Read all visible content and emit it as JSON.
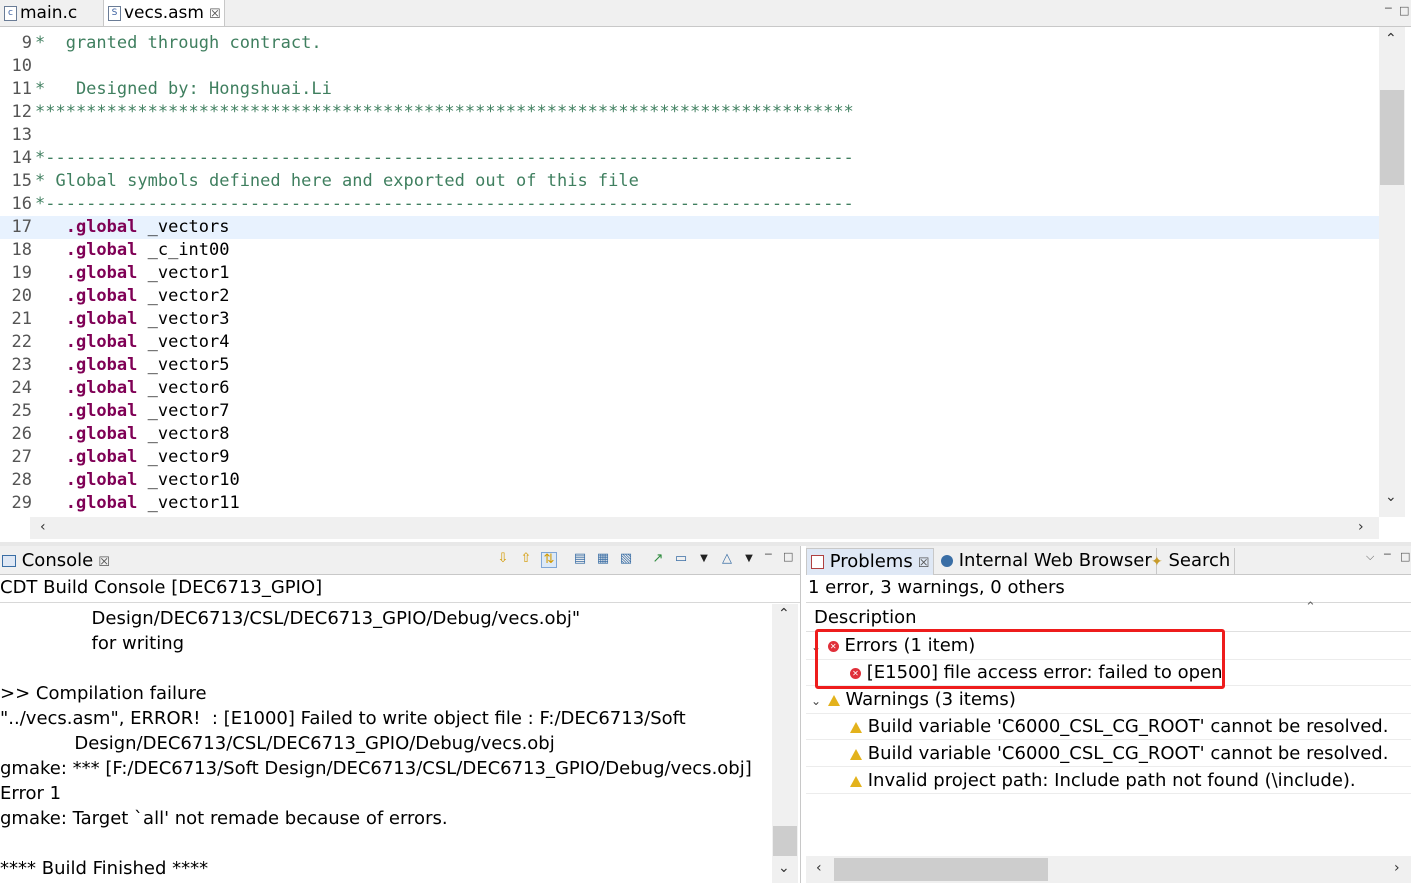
{
  "editor": {
    "tabs": [
      {
        "label": "main.c",
        "active": false
      },
      {
        "label": "vecs.asm",
        "active": true,
        "close": "☒"
      }
    ],
    "lines": [
      {
        "num": "9",
        "parts": [
          {
            "t": "*  granted through contract.",
            "c": "cm"
          }
        ]
      },
      {
        "num": "10",
        "parts": []
      },
      {
        "num": "11",
        "parts": [
          {
            "t": "*   Designed by: Hongshuai.Li",
            "c": "cm"
          }
        ]
      },
      {
        "num": "12",
        "parts": [
          {
            "t": "********************************************************************************",
            "c": "cm"
          }
        ]
      },
      {
        "num": "13",
        "parts": []
      },
      {
        "num": "14",
        "parts": [
          {
            "t": "*-------------------------------------------------------------------------------",
            "c": "cm"
          }
        ]
      },
      {
        "num": "15",
        "parts": [
          {
            "t": "* Global symbols defined here and exported out of this file",
            "c": "cm"
          }
        ]
      },
      {
        "num": "16",
        "parts": [
          {
            "t": "*-------------------------------------------------------------------------------",
            "c": "cm"
          }
        ]
      },
      {
        "num": "17",
        "hl": true,
        "parts": [
          {
            "t": "   ",
            "c": "tx"
          },
          {
            "t": ".global",
            "c": "kw"
          },
          {
            "t": " _vectors",
            "c": "tx"
          }
        ]
      },
      {
        "num": "18",
        "parts": [
          {
            "t": "   ",
            "c": "tx"
          },
          {
            "t": ".global",
            "c": "kw"
          },
          {
            "t": " _c_int00",
            "c": "tx"
          }
        ]
      },
      {
        "num": "19",
        "parts": [
          {
            "t": "   ",
            "c": "tx"
          },
          {
            "t": ".global",
            "c": "kw"
          },
          {
            "t": " _vector1",
            "c": "tx"
          }
        ]
      },
      {
        "num": "20",
        "parts": [
          {
            "t": "   ",
            "c": "tx"
          },
          {
            "t": ".global",
            "c": "kw"
          },
          {
            "t": " _vector2",
            "c": "tx"
          }
        ]
      },
      {
        "num": "21",
        "parts": [
          {
            "t": "   ",
            "c": "tx"
          },
          {
            "t": ".global",
            "c": "kw"
          },
          {
            "t": " _vector3",
            "c": "tx"
          }
        ]
      },
      {
        "num": "22",
        "parts": [
          {
            "t": "   ",
            "c": "tx"
          },
          {
            "t": ".global",
            "c": "kw"
          },
          {
            "t": " _vector4",
            "c": "tx"
          }
        ]
      },
      {
        "num": "23",
        "parts": [
          {
            "t": "   ",
            "c": "tx"
          },
          {
            "t": ".global",
            "c": "kw"
          },
          {
            "t": " _vector5",
            "c": "tx"
          }
        ]
      },
      {
        "num": "24",
        "parts": [
          {
            "t": "   ",
            "c": "tx"
          },
          {
            "t": ".global",
            "c": "kw"
          },
          {
            "t": " _vector6",
            "c": "tx"
          }
        ]
      },
      {
        "num": "25",
        "parts": [
          {
            "t": "   ",
            "c": "tx"
          },
          {
            "t": ".global",
            "c": "kw"
          },
          {
            "t": " _vector7",
            "c": "tx"
          }
        ]
      },
      {
        "num": "26",
        "parts": [
          {
            "t": "   ",
            "c": "tx"
          },
          {
            "t": ".global",
            "c": "kw"
          },
          {
            "t": " _vector8",
            "c": "tx"
          }
        ]
      },
      {
        "num": "27",
        "parts": [
          {
            "t": "   ",
            "c": "tx"
          },
          {
            "t": ".global",
            "c": "kw"
          },
          {
            "t": " _vector9",
            "c": "tx"
          }
        ]
      },
      {
        "num": "28",
        "parts": [
          {
            "t": "   ",
            "c": "tx"
          },
          {
            "t": ".global",
            "c": "kw"
          },
          {
            "t": " _vector10",
            "c": "tx"
          }
        ]
      },
      {
        "num": "29",
        "parts": [
          {
            "t": "   ",
            "c": "tx"
          },
          {
            "t": ".global",
            "c": "kw"
          },
          {
            "t": " _vector11",
            "c": "tx"
          }
        ]
      }
    ]
  },
  "console": {
    "tab_label": "Console",
    "close": "☒",
    "title": "CDT Build Console [DEC6713_GPIO]",
    "output": [
      "                Design/DEC6713/CSL/DEC6713_GPIO/Debug/vecs.obj\"",
      "                for writing",
      "",
      ">> Compilation failure",
      "\"../vecs.asm\", ERROR!  : [E1000] Failed to write object file : F:/DEC6713/Soft",
      "             Design/DEC6713/CSL/DEC6713_GPIO/Debug/vecs.obj",
      "gmake: *** [F:/DEC6713/Soft Design/DEC6713/CSL/DEC6713_GPIO/Debug/vecs.obj]",
      "Error 1",
      "gmake: Target `all' not remade because of errors.",
      "",
      "**** Build Finished ****"
    ]
  },
  "problems": {
    "tabs": [
      {
        "label": "Problems",
        "close": "☒"
      },
      {
        "label": "Internal Web Browser"
      },
      {
        "label": "Search"
      }
    ],
    "summary": "1 error, 3 warnings, 0 others",
    "column_header": "Description",
    "errors_group": "Errors (1 item)",
    "error_items": [
      "[E1500] file access error:  failed to open"
    ],
    "warnings_group": "Warnings (3 items)",
    "warning_items": [
      "Build variable 'C6000_CSL_CG_ROOT' cannot be resolved.",
      "Build variable 'C6000_CSL_CG_ROOT' cannot be resolved.",
      "Invalid project path: Include path not found (\\include)."
    ]
  },
  "colors": {
    "comment": "#3f7f5f",
    "keyword": "#7f0055",
    "highlight_box": "#ee1c1c",
    "current_line": "#e8f2fe"
  }
}
